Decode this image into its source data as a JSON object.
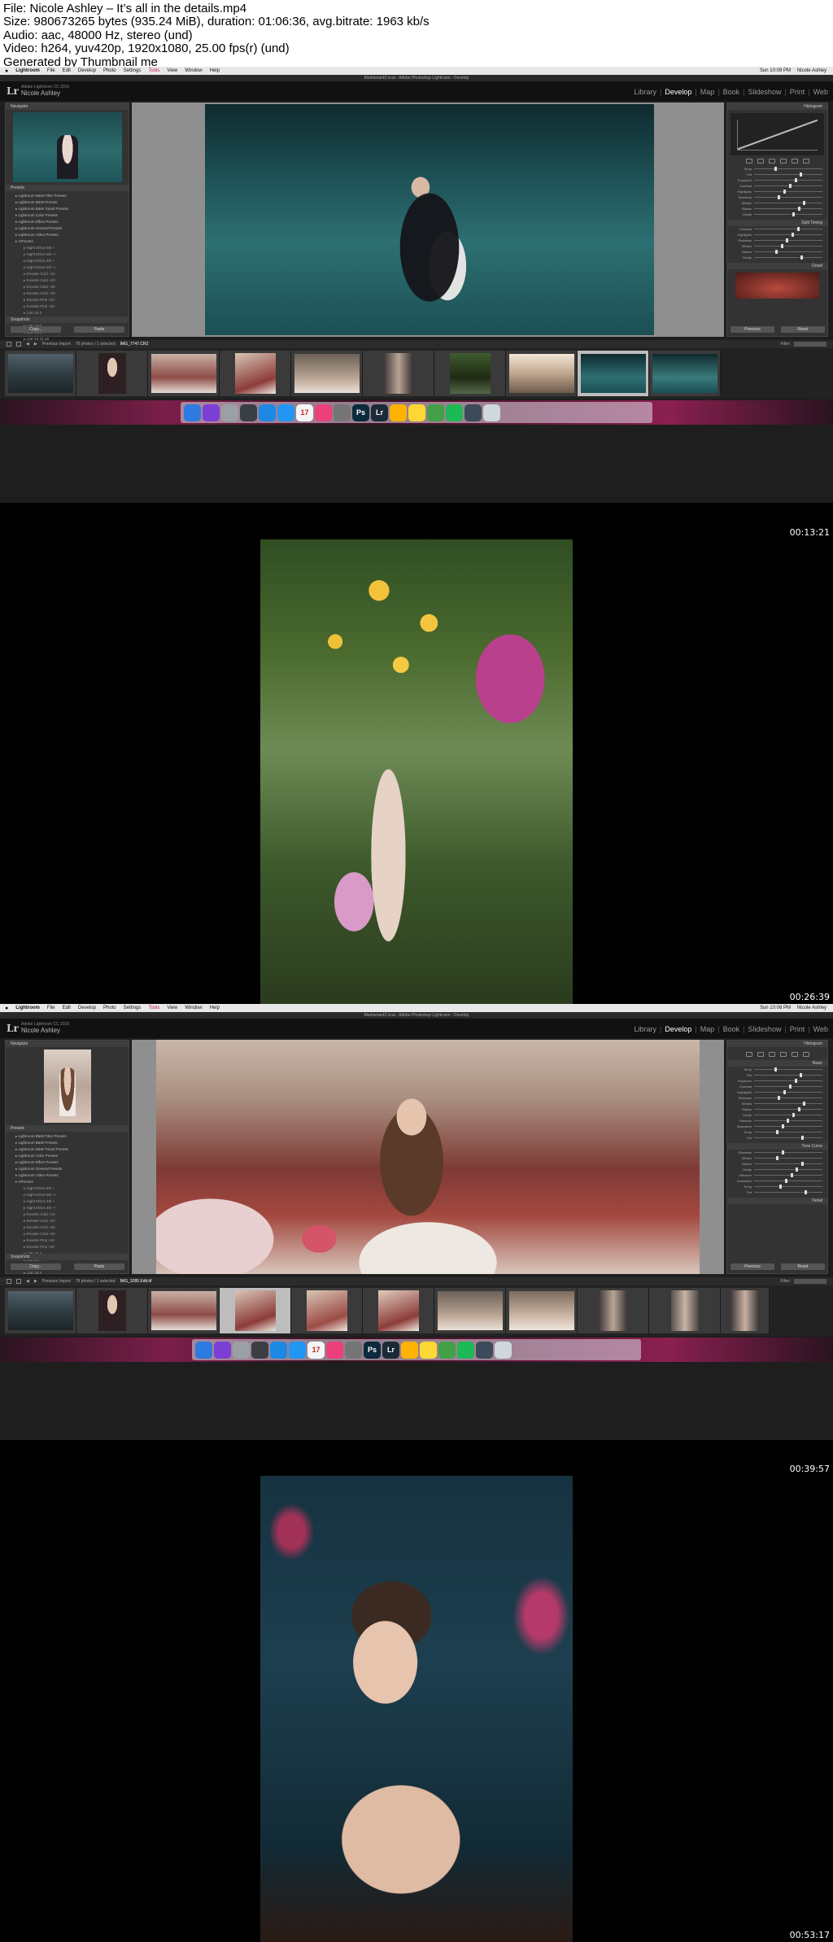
{
  "info": {
    "line1": "File: Nicole Ashley – It’s all in the details.mp4",
    "line2": "Size: 980673265 bytes (935.24 MiB), duration: 01:06:36, avg.bitrate: 1963 kb/s",
    "line3": "Audio: aac, 48000 Hz, stereo (und)",
    "line4": "Video: h264, yuv420p, 1920x1080, 25.00 fps(r) (und)",
    "line5": "Generated by Thumbnail me"
  },
  "frames": [
    {
      "timestamp": "00:13:21",
      "menubar": {
        "items": [
          "Lightroom",
          "File",
          "Edit",
          "Develop",
          "Photo",
          "Settings",
          "Tools",
          "View",
          "Window",
          "Help"
        ],
        "time": "Sun 10:09 PM",
        "user": "Nicole Ashley"
      },
      "window_title": "Maintenant2.lrcat - Adobe Photoshop Lightroom - Develop",
      "identity": {
        "small": "Adobe Lightroom CC 2015",
        "name": "Nicole Ashley"
      },
      "modules": [
        "Library",
        "Develop",
        "Map",
        "Book",
        "Slideshow",
        "Print",
        "Web"
      ],
      "active_module": "Develop",
      "left_panel": {
        "navigator": "Navigator",
        "presets": "Presets",
        "snapshots": "Snapshots",
        "copy": "Copy...",
        "paste": "Paste"
      },
      "right_panel": {
        "histogram": "Histogram",
        "tone": "Tone Curve",
        "split": "Split Toning",
        "detail": "Detail",
        "previous": "Previous",
        "reset": "Reset"
      },
      "filmbar": {
        "source": "Previous Import",
        "count": "79 photos / 1 selected",
        "file": "IMG_7747.CR2",
        "filter": "Filter:"
      }
    },
    {
      "timestamp": "00:26:39"
    },
    {
      "timestamp": "00:39:57",
      "menubar": {
        "items": [
          "Lightroom",
          "File",
          "Edit",
          "Develop",
          "Photo",
          "Settings",
          "Tools",
          "View",
          "Window",
          "Help"
        ],
        "time": "Sun 10:08 PM",
        "user": "Nicole Ashley"
      },
      "window_title": "Maintenant2.lrcat - Adobe Photoshop Lightroom - Develop",
      "identity": {
        "small": "Adobe Lightroom CC 2015",
        "name": "Nicole Ashley"
      },
      "modules": [
        "Library",
        "Develop",
        "Map",
        "Book",
        "Slideshow",
        "Print",
        "Web"
      ],
      "active_module": "Develop",
      "left_panel": {
        "navigator": "Navigator",
        "presets": "Presets",
        "snapshots": "Snapshots",
        "copy": "Copy...",
        "paste": "Paste"
      },
      "right_panel": {
        "histogram": "Histogram",
        "tone": "Basic",
        "split": "Tone Curve",
        "detail": "Detail",
        "previous": "Previous",
        "reset": "Reset"
      },
      "filmbar": {
        "source": "Previous Import",
        "count": "79 photos / 1 selected",
        "file": "IMG_3285 Edit.tif",
        "filter": "Filter:"
      }
    },
    {
      "timestamp": "00:53:17"
    }
  ],
  "preset_items": [
    "Lightroom B&W Filter Presets",
    "Lightroom B&W Presets",
    "Lightroom B&W Toned Presets",
    "Lightroom Color Presets",
    "Lightroom Effect Presets",
    "Lightroom General Presets",
    "Lightroom Video Presets",
    "VPresets"
  ],
  "preset_subitems": [
    "Night Ethos 5th +",
    "Night Ethos 5th ++",
    "Night Ethos 4th +",
    "Night Ethos 4th ++",
    "Rosette Gold +10",
    "Rosette Gold +20",
    "Rosette Gold +30",
    "Rosette Gold +40",
    "Rosette Pink +20",
    "Rosette Pink +30",
    "LSE 16.3",
    "LSE 16.7",
    "LSE 18.0",
    "LSE 18.3",
    "LSE 18.33 1B",
    "LSE 18.36 1B",
    "Newfriends 1"
  ],
  "preset_tail": [
    "XXC2 Film 01",
    "XXC2 Film Extra",
    "XXC2 Film Grains",
    "XXC2 Film 03",
    "User Presets"
  ],
  "slider_labels": [
    "Temp",
    "Tint",
    "Exposure",
    "Contrast",
    "Highlights",
    "Shadows",
    "Whites",
    "Blacks",
    "Clarity",
    "Vibrance",
    "Saturation"
  ],
  "dock_apps": [
    {
      "name": "finder-icon",
      "label": "",
      "color": "#2d7be0"
    },
    {
      "name": "siri-icon",
      "label": "",
      "color": "#7b3fd6"
    },
    {
      "name": "launchpad-icon",
      "label": "",
      "color": "#9aa0a6"
    },
    {
      "name": "mission-control-icon",
      "label": "",
      "color": "#3a3f44"
    },
    {
      "name": "app-store-icon",
      "label": "",
      "color": "#1e88e5"
    },
    {
      "name": "safari-icon",
      "label": "",
      "color": "#2196f3"
    },
    {
      "name": "calendar-icon",
      "label": "17",
      "color": "#f5f5f5"
    },
    {
      "name": "itunes-icon",
      "label": "",
      "color": "#ec407a"
    },
    {
      "name": "system-prefs-icon",
      "label": "",
      "color": "#757575"
    },
    {
      "name": "photoshop-icon",
      "label": "Ps",
      "color": "#0b2a3d"
    },
    {
      "name": "lightroom-icon",
      "label": "Lr",
      "color": "#1b2a38"
    },
    {
      "name": "photos-icon",
      "label": "",
      "color": "#ffb300"
    },
    {
      "name": "notes-icon",
      "label": "",
      "color": "#fdd835"
    },
    {
      "name": "numbers-icon",
      "label": "",
      "color": "#43a047"
    },
    {
      "name": "spotify-icon",
      "label": "",
      "color": "#1db954"
    },
    {
      "name": "quicktime-icon",
      "label": "",
      "color": "#3b4b5b"
    },
    {
      "name": "trash-icon",
      "label": "",
      "color": "#cfd8dc"
    }
  ]
}
